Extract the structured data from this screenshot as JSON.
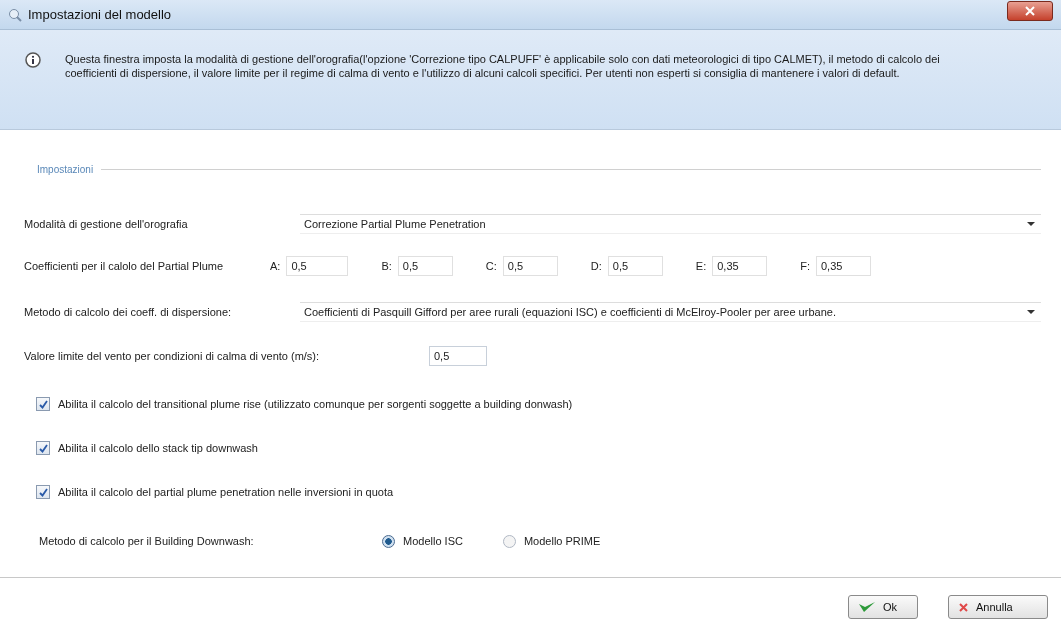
{
  "window": {
    "title": "Impostazioni del modello"
  },
  "info": {
    "text": "Questa finestra imposta la modalità di gestione dell'orografia(l'opzione 'Correzione tipo CALPUFF' è applicabile solo con dati meteorologici di tipo CALMET), il metodo di calcolo dei coefficienti di dispersione, il valore limite per il regime di calma di vento e l'utilizzo di alcuni calcoli specifici. Per utenti non esperti si consiglia di mantenere i valori di default."
  },
  "group": {
    "title": "Impostazioni"
  },
  "orography": {
    "label": "Modalità di gestione dell'orografia",
    "value": "Correzione Partial Plume Penetration"
  },
  "coefficients": {
    "label": "Coefficienti per il calolo del Partial Plume",
    "fields": [
      {
        "key": "A:",
        "value": "0,5"
      },
      {
        "key": "B:",
        "value": "0,5"
      },
      {
        "key": "C:",
        "value": "0,5"
      },
      {
        "key": "D:",
        "value": "0,5"
      },
      {
        "key": "E:",
        "value": "0,35"
      },
      {
        "key": "F:",
        "value": "0,35"
      }
    ]
  },
  "dispersion": {
    "label": "Metodo di calcolo dei coeff. di dispersione:",
    "value": "Coefficienti di Pasquill Gifford per aree rurali  (equazioni ISC) e coefficienti di McElroy-Pooler per aree urbane."
  },
  "wind_limit": {
    "label": "Valore limite del vento per condizioni di calma di vento (m/s):",
    "value": "0,5"
  },
  "options": [
    {
      "label": "Abilita il calcolo del transitional plume rise (utilizzato comunque per sorgenti soggette a building donwash)",
      "checked": true
    },
    {
      "label": "Abilita il calcolo dello stack tip downwash",
      "checked": true
    },
    {
      "label": "Abilita il calcolo del partial plume penetration nelle inversioni in quota",
      "checked": true
    }
  ],
  "downwash": {
    "label": "Metodo di calcolo per il Building Downwash:",
    "options": [
      {
        "label": "Modello ISC",
        "selected": true
      },
      {
        "label": "Modello PRIME",
        "selected": false
      }
    ]
  },
  "buttons": [
    {
      "label": "Ok",
      "kind": "ok"
    },
    {
      "label": "Annulla",
      "kind": "cancel"
    }
  ]
}
